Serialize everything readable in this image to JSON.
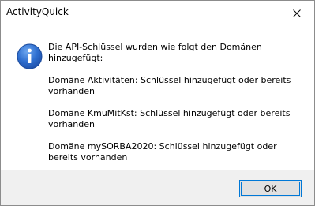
{
  "window": {
    "title": "ActivityQuick",
    "close_icon": "close-icon"
  },
  "dialog": {
    "icon": "info-icon",
    "lines": [
      "Die API-Schlüssel wurden wie folgt den Domänen hinzugefügt:",
      "Domäne Aktivitäten: Schlüssel hinzugefügt oder bereits vorhanden",
      "Domäne KmuMitKst: Schlüssel hinzugefügt oder bereits vorhanden",
      "Domäne mySORBA2020: Schlüssel hinzugefügt oder bereits vorhanden"
    ]
  },
  "footer": {
    "ok_label": "OK"
  }
}
